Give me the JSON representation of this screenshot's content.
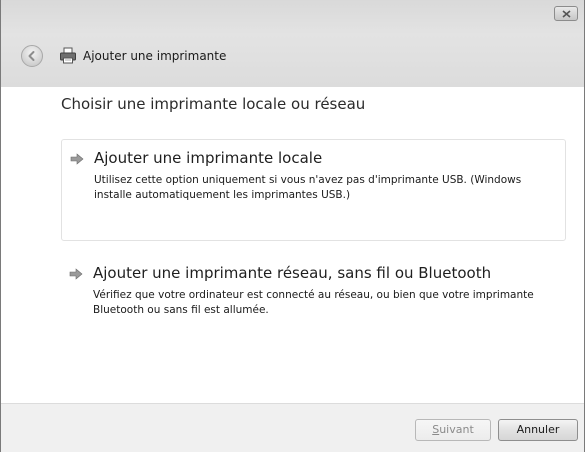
{
  "window": {
    "title": "Ajouter une imprimante"
  },
  "main": {
    "heading": "Choisir une imprimante locale ou réseau",
    "options": [
      {
        "title": "Ajouter une imprimante locale",
        "description": "Utilisez cette option uniquement si vous n'avez pas d'imprimante USB. (Windows installe automatiquement les imprimantes USB.)"
      },
      {
        "title": "Ajouter une imprimante réseau, sans fil ou Bluetooth",
        "description": "Vérifiez que votre ordinateur est connecté au réseau, ou bien que votre imprimante Bluetooth ou sans fil est allumée."
      }
    ]
  },
  "footer": {
    "next_label_mnemonic": "S",
    "next_label_rest": "uivant",
    "cancel_label": "Annuler"
  },
  "icons": {
    "close": "close-icon",
    "back": "back-arrow-icon",
    "printer": "printer-icon",
    "option_arrow": "green-arrow-icon"
  }
}
